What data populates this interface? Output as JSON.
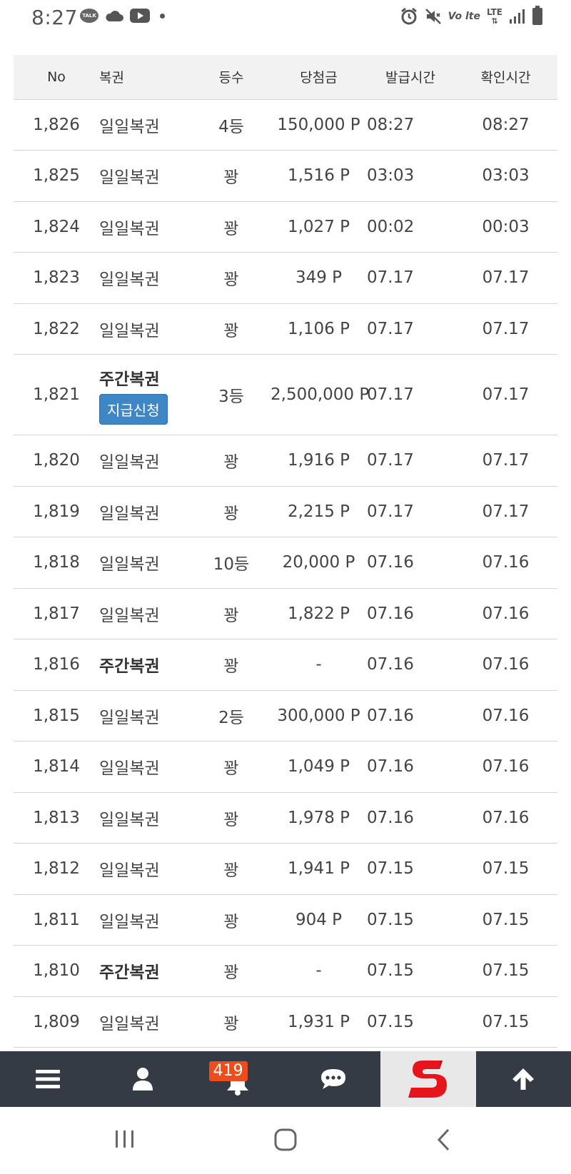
{
  "status_bar": {
    "time": "8:27",
    "talk_label": "TALK",
    "volte_label": "Vo lte",
    "lte_label": "LTE"
  },
  "table": {
    "headers": {
      "no": "No",
      "lottery": "복권",
      "rank": "등수",
      "prize": "당첨금",
      "issued": "발급시간",
      "checked": "확인시간"
    },
    "rows": [
      {
        "no": "1,826",
        "lottery": "일일복권",
        "rank": "4등",
        "prize": "150,000 P",
        "issued": "08:27",
        "checked": "08:27"
      },
      {
        "no": "1,825",
        "lottery": "일일복권",
        "rank": "꽝",
        "prize": "1,516 P",
        "issued": "03:03",
        "checked": "03:03"
      },
      {
        "no": "1,824",
        "lottery": "일일복권",
        "rank": "꽝",
        "prize": "1,027 P",
        "issued": "00:02",
        "checked": "00:03"
      },
      {
        "no": "1,823",
        "lottery": "일일복권",
        "rank": "꽝",
        "prize": "349 P",
        "issued": "07.17",
        "checked": "07.17"
      },
      {
        "no": "1,822",
        "lottery": "일일복권",
        "rank": "꽝",
        "prize": "1,106 P",
        "issued": "07.17",
        "checked": "07.17"
      },
      {
        "no": "1,821",
        "lottery": "주간복권",
        "claim": "지급신청",
        "rank": "3등",
        "prize": "2,500,000 P",
        "issued": "07.17",
        "checked": "07.17"
      },
      {
        "no": "1,820",
        "lottery": "일일복권",
        "rank": "꽝",
        "prize": "1,916 P",
        "issued": "07.17",
        "checked": "07.17"
      },
      {
        "no": "1,819",
        "lottery": "일일복권",
        "rank": "꽝",
        "prize": "2,215 P",
        "issued": "07.17",
        "checked": "07.17"
      },
      {
        "no": "1,818",
        "lottery": "일일복권",
        "rank": "10등",
        "prize": "20,000 P",
        "issued": "07.16",
        "checked": "07.16"
      },
      {
        "no": "1,817",
        "lottery": "일일복권",
        "rank": "꽝",
        "prize": "1,822 P",
        "issued": "07.16",
        "checked": "07.16"
      },
      {
        "no": "1,816",
        "lottery": "주간복권",
        "rank": "꽝",
        "prize": "-",
        "issued": "07.16",
        "checked": "07.16"
      },
      {
        "no": "1,815",
        "lottery": "일일복권",
        "rank": "2등",
        "prize": "300,000 P",
        "issued": "07.16",
        "checked": "07.16"
      },
      {
        "no": "1,814",
        "lottery": "일일복권",
        "rank": "꽝",
        "prize": "1,049 P",
        "issued": "07.16",
        "checked": "07.16"
      },
      {
        "no": "1,813",
        "lottery": "일일복권",
        "rank": "꽝",
        "prize": "1,978 P",
        "issued": "07.16",
        "checked": "07.16"
      },
      {
        "no": "1,812",
        "lottery": "일일복권",
        "rank": "꽝",
        "prize": "1,941 P",
        "issued": "07.15",
        "checked": "07.15"
      },
      {
        "no": "1,811",
        "lottery": "일일복권",
        "rank": "꽝",
        "prize": "904 P",
        "issued": "07.15",
        "checked": "07.15"
      },
      {
        "no": "1,810",
        "lottery": "주간복권",
        "rank": "꽝",
        "prize": "-",
        "issued": "07.15",
        "checked": "07.15"
      },
      {
        "no": "1,809",
        "lottery": "일일복권",
        "rank": "꽝",
        "prize": "1,931 P",
        "issued": "07.15",
        "checked": "07.15"
      }
    ]
  },
  "bottom_nav": {
    "notification_count": "419",
    "icons": [
      "menu-icon",
      "user-icon",
      "bell-icon",
      "chat-icon",
      "site-logo",
      "arrow-up-icon"
    ]
  },
  "colors": {
    "claim_button": "#3f86c7",
    "nav_background": "#343b44",
    "badge": "#ee4c1a",
    "logo_red": "#e8141b"
  }
}
